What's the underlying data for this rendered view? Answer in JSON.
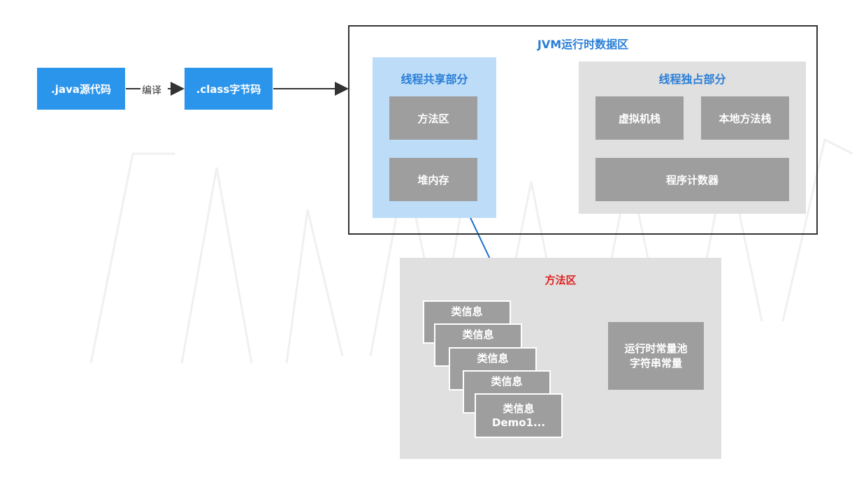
{
  "source_label": ".java源代码",
  "compile_label": "编译",
  "class_label": ".class字节码",
  "jvm": {
    "title": "JVM运行时数据区",
    "shared": {
      "title": "线程共享部分",
      "method_area": "方法区",
      "heap": "堆内存"
    },
    "exclusive": {
      "title": "线程独占部分",
      "vm_stack": "虚拟机栈",
      "native_stack": "本地方法栈",
      "pc_register": "程序计数器"
    }
  },
  "method_area_detail": {
    "title": "方法区",
    "class_info_cards": [
      {
        "line1": "类信息",
        "line2": ""
      },
      {
        "line1": "类信息",
        "line2": ""
      },
      {
        "line1": "类信息",
        "line2": ""
      },
      {
        "line1": "类信息",
        "line2": ""
      },
      {
        "line1": "类信息",
        "line2": "Demo1..."
      }
    ],
    "constant_pool_line1": "运行时常量池",
    "constant_pool_line2": "字符串常量"
  },
  "colors": {
    "blue_box": "#2b95ec",
    "gray_box": "#9e9e9e",
    "shared_bg": "#bcdcf8",
    "exclusive_bg": "#e0e0e0",
    "title_blue": "#2a7ed6",
    "title_red": "#e02020",
    "arrow_blue": "#1e6fd0"
  }
}
